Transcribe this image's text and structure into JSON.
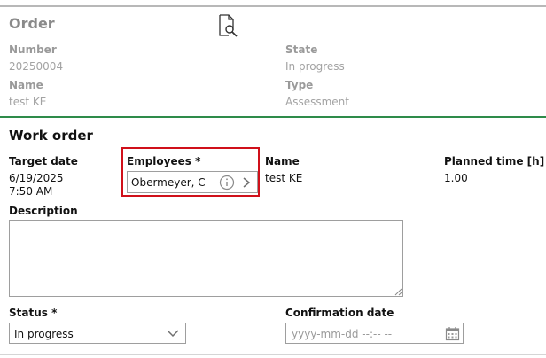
{
  "order": {
    "title": "Order",
    "number_label": "Number",
    "number_value": "20250004",
    "state_label": "State",
    "state_value": "In progress",
    "name_label": "Name",
    "name_value": "test KE",
    "type_label": "Type",
    "type_value": "Assessment"
  },
  "work_order": {
    "title": "Work order",
    "target_date_label": "Target date",
    "target_date_value": "6/19/2025",
    "target_time_value": "7:50 AM",
    "employees_label": "Employees *",
    "employees_value": "Obermeyer, C",
    "name_label": "Name",
    "name_value": "test KE",
    "planned_time_label": "Planned time [h]",
    "planned_time_value": "1.00",
    "description_label": "Description",
    "description_value": "",
    "status_label": "Status *",
    "status_value": "In progress",
    "confirmation_label": "Confirmation date",
    "confirmation_placeholder": "yyyy-mm-dd --:-- --"
  },
  "colors": {
    "highlight": "#d0101a",
    "divider": "#2e8b4a"
  },
  "icons": [
    "document-search-icon",
    "info-icon",
    "chevron-right-icon",
    "chevron-down-icon",
    "calendar-icon"
  ]
}
